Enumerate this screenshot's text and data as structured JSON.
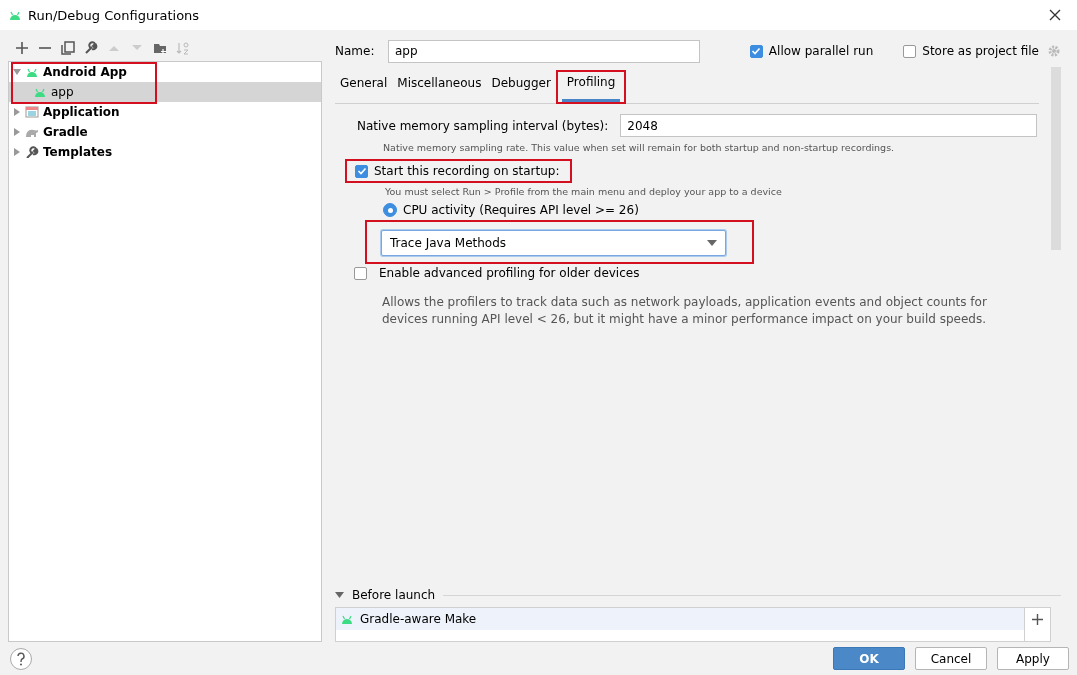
{
  "window": {
    "title": "Run/Debug Configurations"
  },
  "tree": [
    {
      "label": "Android App",
      "kind": "android",
      "expanded": true,
      "selected": false,
      "highlighted": true,
      "children": [
        {
          "label": "app",
          "kind": "android",
          "selected": true
        }
      ]
    },
    {
      "label": "Application",
      "kind": "application",
      "expanded": false,
      "selected": false
    },
    {
      "label": "Gradle",
      "kind": "gradle",
      "expanded": false,
      "selected": false
    },
    {
      "label": "Templates",
      "kind": "templates",
      "expanded": false,
      "selected": false
    }
  ],
  "name_field": {
    "label": "Name:",
    "value": "app"
  },
  "allow_parallel_run": {
    "label": "Allow parallel run",
    "checked": true
  },
  "store_as_project_file": {
    "label": "Store as project file",
    "checked": false
  },
  "tabs": [
    {
      "label": "General",
      "selected": false,
      "highlighted": false
    },
    {
      "label": "Miscellaneous",
      "selected": false,
      "highlighted": false
    },
    {
      "label": "Debugger",
      "selected": false,
      "highlighted": false
    },
    {
      "label": "Profiling",
      "selected": true,
      "highlighted": true
    }
  ],
  "profiling": {
    "interval": {
      "label": "Native memory sampling interval (bytes):",
      "value": "2048",
      "hint": "Native memory sampling rate. This value when set will remain for both startup and non-startup recordings."
    },
    "startup": {
      "label": "Start this recording on startup:",
      "checked": true,
      "highlighted": true,
      "hint": "You must select Run > Profile from the main menu and deploy your app to a device"
    },
    "cpu": {
      "label": "CPU activity (Requires API level >= 26)",
      "selected": true
    },
    "trace": {
      "value": "Trace Java Methods",
      "highlighted": true
    },
    "advanced": {
      "label": "Enable advanced profiling for older devices",
      "checked": false,
      "description": "Allows the profilers to track data such as network payloads, application events and object counts for devices running API level < 26, but it might have a minor performance impact on your build speeds."
    }
  },
  "before_launch": {
    "title": "Before launch",
    "expanded": true,
    "tasks": [
      {
        "label": "Gradle-aware Make"
      }
    ]
  },
  "buttons": [
    {
      "label": "OK",
      "kind": "primary"
    },
    {
      "label": "Cancel",
      "kind": "normal"
    },
    {
      "label": "Apply",
      "kind": "normal"
    }
  ]
}
